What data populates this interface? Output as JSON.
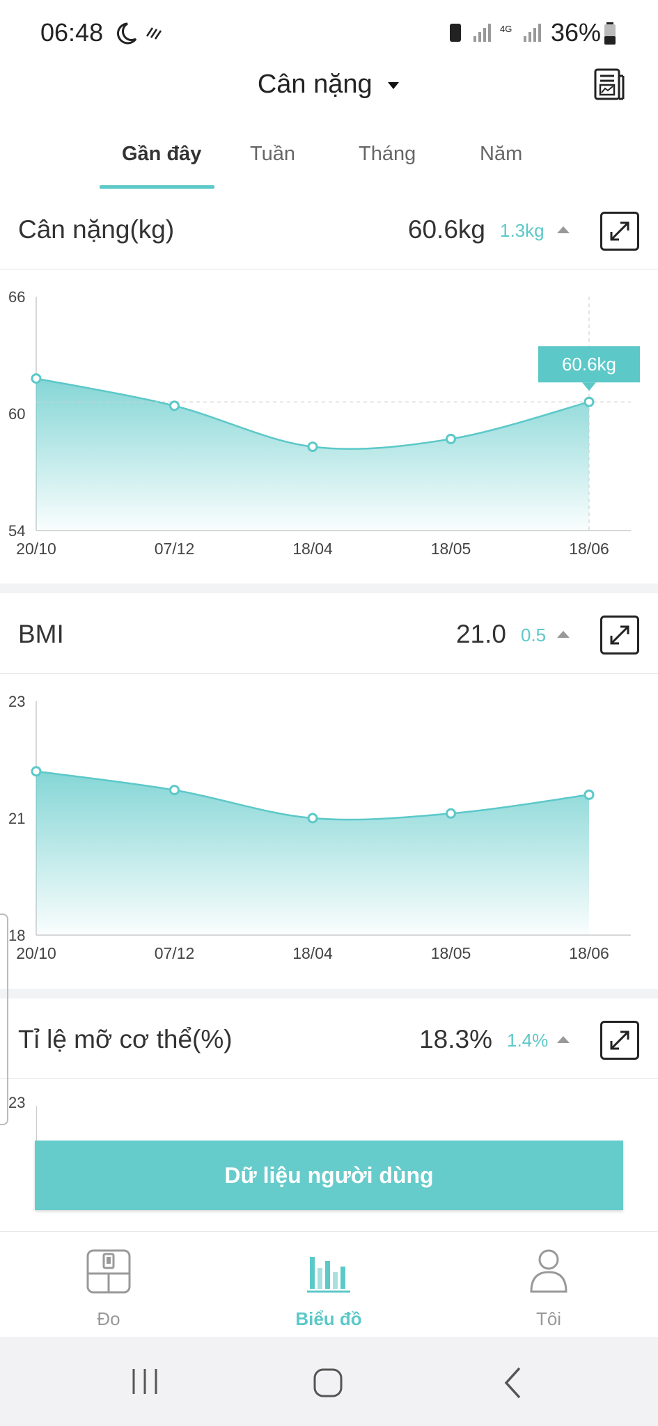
{
  "status_bar": {
    "time": "06:48",
    "battery": "36%"
  },
  "header": {
    "title": "Cân nặng"
  },
  "tabs": [
    {
      "label": "Gần đây"
    },
    {
      "label": "Tuần"
    },
    {
      "label": "Tháng"
    },
    {
      "label": "Năm"
    }
  ],
  "cards": [
    {
      "label": "Cân nặng(kg)",
      "value": "60.6kg",
      "change": "1.3kg"
    },
    {
      "label": "BMI",
      "value": "21.0",
      "change": "0.5"
    },
    {
      "label": "Tỉ lệ mỡ cơ thể(%)",
      "value": "18.3%",
      "change": "1.4%"
    }
  ],
  "chart_data": [
    {
      "type": "area",
      "categories": [
        "20/10",
        "07/12",
        "18/04",
        "18/05",
        "18/06"
      ],
      "values": [
        61.8,
        60.4,
        58.3,
        58.7,
        60.6
      ],
      "y_ticks": [
        "66",
        "60",
        "54"
      ],
      "ylim": [
        54,
        66
      ],
      "tooltip": "60.6kg",
      "color": "#5cc8c8"
    },
    {
      "type": "area",
      "categories": [
        "20/10",
        "07/12",
        "18/04",
        "18/05",
        "18/06"
      ],
      "values": [
        21.5,
        21.1,
        20.5,
        20.6,
        21.0
      ],
      "y_ticks": [
        "23",
        "21",
        "18"
      ],
      "ylim": [
        18,
        23
      ],
      "color": "#5cc8c8"
    }
  ],
  "partial_chart": {
    "top_tick": "23"
  },
  "cta": {
    "label": "Dữ liệu người dùng"
  },
  "bottom_nav": [
    {
      "label": "Đo",
      "icon": "scale-icon"
    },
    {
      "label": "Biểu đồ",
      "icon": "bar-chart-icon"
    },
    {
      "label": "Tôi",
      "icon": "person-icon"
    }
  ],
  "colors": {
    "accent": "#5cc8c8",
    "text": "#333333",
    "muted": "#999999"
  }
}
